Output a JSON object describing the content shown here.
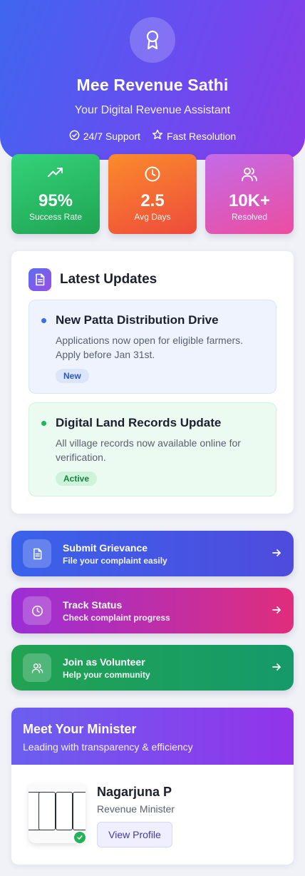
{
  "hero": {
    "icon": "award-icon",
    "title": "Mee Revenue Sathi",
    "subtitle": "Your Digital Revenue Assistant",
    "tags": [
      {
        "icon": "check-circle-icon",
        "label": "24/7 Support"
      },
      {
        "icon": "star-icon",
        "label": "Fast Resolution"
      }
    ]
  },
  "stats": [
    {
      "icon": "trending-up-icon",
      "value": "95%",
      "label": "Success Rate",
      "color": "#22b35e"
    },
    {
      "icon": "clock-icon",
      "value": "2.5",
      "label": "Avg Days",
      "color": "#f26a33"
    },
    {
      "icon": "users-icon",
      "value": "10K+",
      "label": "Resolved",
      "color": "#d95cc4"
    }
  ],
  "updates": {
    "icon": "document-icon",
    "title": "Latest Updates",
    "items": [
      {
        "title": "New Patta Distribution Drive",
        "description": "Applications now open for eligible farmers. Apply before Jan 31st.",
        "badge": "New"
      },
      {
        "title": "Digital Land Records Update",
        "description": "All village records now available online for verification.",
        "badge": "Active"
      }
    ]
  },
  "actions": [
    {
      "icon": "document-icon",
      "title": "Submit Grievance",
      "description": "File your complaint easily",
      "color": "#3f5ce8"
    },
    {
      "icon": "clock-icon",
      "title": "Track Status",
      "description": "Check complaint progress",
      "color": "#b52dc0"
    },
    {
      "icon": "users-icon",
      "title": "Join as Volunteer",
      "description": "Help your community",
      "color": "#1ea05a"
    }
  ],
  "minister": {
    "heading": "Meet Your Minister",
    "subheading": "Leading with transparency & efficiency",
    "name": "Nagarjuna P",
    "role": "Revenue Minister",
    "button": "View Profile"
  }
}
